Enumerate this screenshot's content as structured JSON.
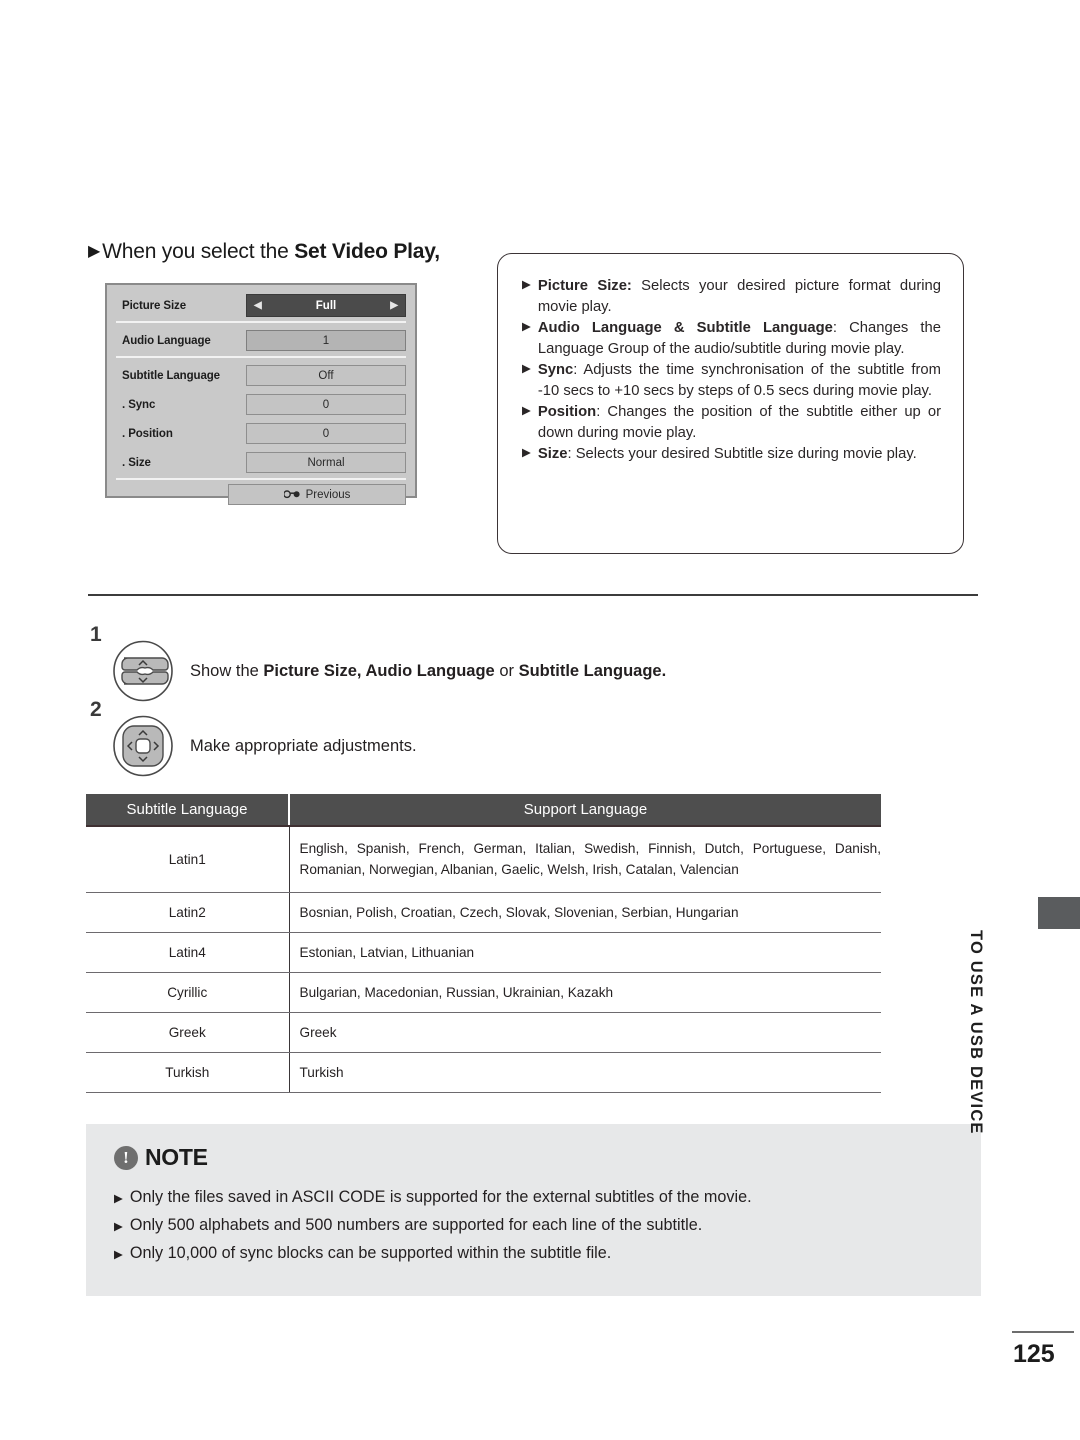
{
  "section": {
    "bullet": "▶",
    "title_prefix": "When you select the ",
    "title_bold": "Set Video Play,"
  },
  "osd": {
    "rows": [
      {
        "label": "Picture Size",
        "value": "Full",
        "style": "highlight",
        "has_arrows": true
      },
      {
        "label": "Audio Language",
        "value": "1",
        "style": "selected-grey",
        "has_arrows": false
      },
      {
        "label": "Subtitle Language",
        "value": "Off",
        "style": "normal",
        "has_arrows": false
      },
      {
        "label": ". Sync",
        "value": "0",
        "style": "normal",
        "has_arrows": false
      },
      {
        "label": ". Position",
        "value": "0",
        "style": "normal",
        "has_arrows": false
      },
      {
        "label": ". Size",
        "value": "Normal",
        "style": "normal",
        "has_arrows": false
      }
    ],
    "arrow_left": "◀",
    "arrow_right": "▶",
    "previous_label": "Previous",
    "previous_icon": "return-arrow-icon"
  },
  "descriptions": [
    {
      "bullet": "▶",
      "term": "Picture Size:",
      "text": " Selects your desired picture format during movie play."
    },
    {
      "bullet": "▶",
      "term": "Audio Language & Subtitle Language",
      "text": ": Changes the Language Group of the audio/subtitle during movie play."
    },
    {
      "bullet": "▶",
      "term": "Sync",
      "text": ": Adjusts the time synchronisation of the subtitle from -10 secs to +10 secs by steps of 0.5 secs during movie play."
    },
    {
      "bullet": "▶",
      "term": "Position",
      "text": ": Changes the position of the subtitle either up or down during movie play."
    },
    {
      "bullet": "▶",
      "term": "Size",
      "text": ": Selects your desired Subtitle size during movie play."
    }
  ],
  "steps": [
    {
      "number": "1",
      "icon": "up-down-navigation-button-icon",
      "text_parts": [
        {
          "t": "Show the ",
          "b": false
        },
        {
          "t": "Picture Size, Audio Language",
          "b": true
        },
        {
          "t": " or ",
          "b": false
        },
        {
          "t": "Subtitle Language.",
          "b": true
        }
      ]
    },
    {
      "number": "2",
      "icon": "four-way-navigation-button-icon",
      "text_parts": [
        {
          "t": "Make appropriate adjustments.",
          "b": false
        }
      ]
    }
  ],
  "language_table": {
    "headers": [
      "Subtitle Language",
      "Support Language"
    ],
    "rows": [
      {
        "group": "Latin1",
        "languages": "English, Spanish, French, German, Italian, Swedish, Finnish, Dutch, Portuguese, Danish, Romanian, Norwegian, Albanian, Gaelic, Welsh, Irish, Catalan, Valencian",
        "tall": true
      },
      {
        "group": "Latin2",
        "languages": "Bosnian, Polish, Croatian, Czech, Slovak, Slovenian, Serbian, Hungarian",
        "tall": false
      },
      {
        "group": "Latin4",
        "languages": "Estonian, Latvian, Lithuanian",
        "tall": false
      },
      {
        "group": "Cyrillic",
        "languages": "Bulgarian, Macedonian, Russian, Ukrainian, Kazakh",
        "tall": false
      },
      {
        "group": "Greek",
        "languages": "Greek",
        "tall": false
      },
      {
        "group": "Turkish",
        "languages": "Turkish",
        "tall": false
      }
    ]
  },
  "note": {
    "icon": "exclamation-circle-icon",
    "icon_glyph": "!",
    "title": "NOTE",
    "bullet": "▶",
    "items": [
      "Only the files saved in ASCII CODE is supported for the external subtitles of the movie.",
      "Only 500 alphabets and 500 numbers are supported for each line of the subtitle.",
      "Only 10,000 of sync blocks can be supported within the subtitle file."
    ]
  },
  "chapter": {
    "label": "TO USE A USB DEVICE"
  },
  "footer": {
    "page_number": "125"
  },
  "colors": {
    "osd_background": "#c9c9c9",
    "osd_highlight": "#4b4b4b",
    "table_header": "#4e4e4e",
    "note_background": "#e7e8e9",
    "chapter_tab": "#5a5c5e",
    "text": "#231f20"
  }
}
